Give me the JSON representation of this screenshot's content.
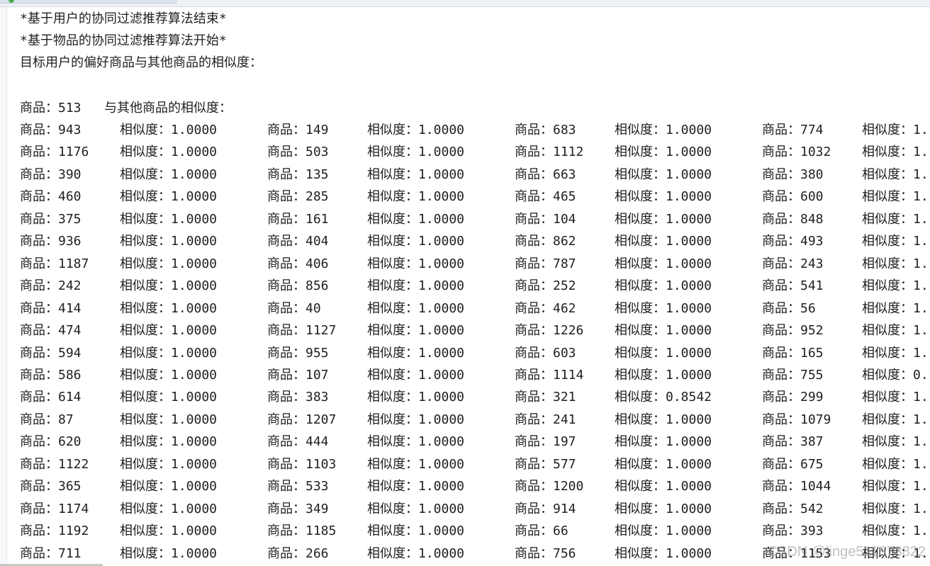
{
  "console": {
    "header_lines": [
      "*基于用户的协同过滤推荐算法结束*",
      "*基于物品的协同过滤推荐算法开始*",
      "目标用户的偏好商品与其他商品的相似度：",
      "",
      "商品：513   与其他商品的相似度："
    ],
    "rows": [
      [
        [
          "商品：943",
          "相似度：1.0000"
        ],
        [
          "商品：149",
          "相似度：1.0000"
        ],
        [
          "商品：683",
          "相似度：1.0000"
        ],
        [
          "商品：774",
          "相似度：1."
        ]
      ],
      [
        [
          "商品：1176",
          "相似度：1.0000"
        ],
        [
          "商品：503",
          "相似度：1.0000"
        ],
        [
          "商品：1112",
          "相似度：1.0000"
        ],
        [
          "商品：1032",
          "相似度：1."
        ]
      ],
      [
        [
          "商品：390",
          "相似度：1.0000"
        ],
        [
          "商品：135",
          "相似度：1.0000"
        ],
        [
          "商品：663",
          "相似度：1.0000"
        ],
        [
          "商品：380",
          "相似度：1."
        ]
      ],
      [
        [
          "商品：460",
          "相似度：1.0000"
        ],
        [
          "商品：285",
          "相似度：1.0000"
        ],
        [
          "商品：465",
          "相似度：1.0000"
        ],
        [
          "商品：600",
          "相似度：1."
        ]
      ],
      [
        [
          "商品：375",
          "相似度：1.0000"
        ],
        [
          "商品：161",
          "相似度：1.0000"
        ],
        [
          "商品：104",
          "相似度：1.0000"
        ],
        [
          "商品：848",
          "相似度：1."
        ]
      ],
      [
        [
          "商品：936",
          "相似度：1.0000"
        ],
        [
          "商品：404",
          "相似度：1.0000"
        ],
        [
          "商品：862",
          "相似度：1.0000"
        ],
        [
          "商品：493",
          "相似度：1."
        ]
      ],
      [
        [
          "商品：1187",
          "相似度：1.0000"
        ],
        [
          "商品：406",
          "相似度：1.0000"
        ],
        [
          "商品：787",
          "相似度：1.0000"
        ],
        [
          "商品：243",
          "相似度：1."
        ]
      ],
      [
        [
          "商品：242",
          "相似度：1.0000"
        ],
        [
          "商品：856",
          "相似度：1.0000"
        ],
        [
          "商品：252",
          "相似度：1.0000"
        ],
        [
          "商品：541",
          "相似度：1."
        ]
      ],
      [
        [
          "商品：414",
          "相似度：1.0000"
        ],
        [
          "商品：40",
          "相似度：1.0000"
        ],
        [
          "商品：462",
          "相似度：1.0000"
        ],
        [
          "商品：56",
          "相似度：1."
        ]
      ],
      [
        [
          "商品：474",
          "相似度：1.0000"
        ],
        [
          "商品：1127",
          "相似度：1.0000"
        ],
        [
          "商品：1226",
          "相似度：1.0000"
        ],
        [
          "商品：952",
          "相似度：1."
        ]
      ],
      [
        [
          "商品：594",
          "相似度：1.0000"
        ],
        [
          "商品：955",
          "相似度：1.0000"
        ],
        [
          "商品：603",
          "相似度：1.0000"
        ],
        [
          "商品：165",
          "相似度：1."
        ]
      ],
      [
        [
          "商品：586",
          "相似度：1.0000"
        ],
        [
          "商品：107",
          "相似度：1.0000"
        ],
        [
          "商品：1114",
          "相似度：1.0000"
        ],
        [
          "商品：755",
          "相似度：0."
        ]
      ],
      [
        [
          "商品：614",
          "相似度：1.0000"
        ],
        [
          "商品：383",
          "相似度：1.0000"
        ],
        [
          "商品：321",
          "相似度：0.8542"
        ],
        [
          "商品：299",
          "相似度：1."
        ]
      ],
      [
        [
          "商品：87",
          "相似度：1.0000"
        ],
        [
          "商品：1207",
          "相似度：1.0000"
        ],
        [
          "商品：241",
          "相似度：1.0000"
        ],
        [
          "商品：1079",
          "相似度：1."
        ]
      ],
      [
        [
          "商品：620",
          "相似度：1.0000"
        ],
        [
          "商品：444",
          "相似度：1.0000"
        ],
        [
          "商品：197",
          "相似度：1.0000"
        ],
        [
          "商品：387",
          "相似度：1."
        ]
      ],
      [
        [
          "商品：1122",
          "相似度：1.0000"
        ],
        [
          "商品：1103",
          "相似度：1.0000"
        ],
        [
          "商品：577",
          "相似度：1.0000"
        ],
        [
          "商品：675",
          "相似度：1."
        ]
      ],
      [
        [
          "商品：365",
          "相似度：1.0000"
        ],
        [
          "商品：533",
          "相似度：1.0000"
        ],
        [
          "商品：1200",
          "相似度：1.0000"
        ],
        [
          "商品：1044",
          "相似度：1."
        ]
      ],
      [
        [
          "商品：1174",
          "相似度：1.0000"
        ],
        [
          "商品：349",
          "相似度：1.0000"
        ],
        [
          "商品：914",
          "相似度：1.0000"
        ],
        [
          "商品：542",
          "相似度：1."
        ]
      ],
      [
        [
          "商品：1192",
          "相似度：1.0000"
        ],
        [
          "商品：1185",
          "相似度：1.0000"
        ],
        [
          "商品：66",
          "相似度：1.0000"
        ],
        [
          "商品：393",
          "相似度：1."
        ]
      ],
      [
        [
          "商品：711",
          "相似度：1.0000"
        ],
        [
          "商品：266",
          "相似度：1.0000"
        ],
        [
          "商品：756",
          "相似度：1.0000"
        ],
        [
          "商品：1153",
          "相似度：1."
        ]
      ]
    ]
  },
  "watermark": "CSDN @linge511873822",
  "colors": {
    "text": "#1f1f1f",
    "background": "#ffffff",
    "watermark": "#8c8c8c"
  }
}
